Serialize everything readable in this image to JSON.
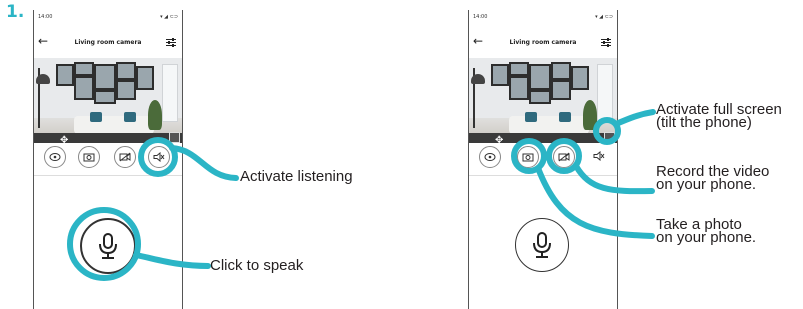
{
  "step_number": "1.",
  "phone": {
    "status_time": "14:00",
    "status_icons": "▾ ◢ ⊂⊃",
    "title": "Living room camera"
  },
  "callouts": {
    "listen": "Activate listening",
    "speak": "Click to speak",
    "fullscreen_line1": "Activate full screen",
    "fullscreen_line2": "(tilt the phone)",
    "record_line1": "Record the video",
    "record_line2": "on your phone.",
    "photo_line1": "Take a photo",
    "photo_line2": "on your phone."
  },
  "icons": {
    "back": "←",
    "move": "✥"
  },
  "colors": {
    "accent": "#2bb5c6",
    "text": "#231f20"
  }
}
